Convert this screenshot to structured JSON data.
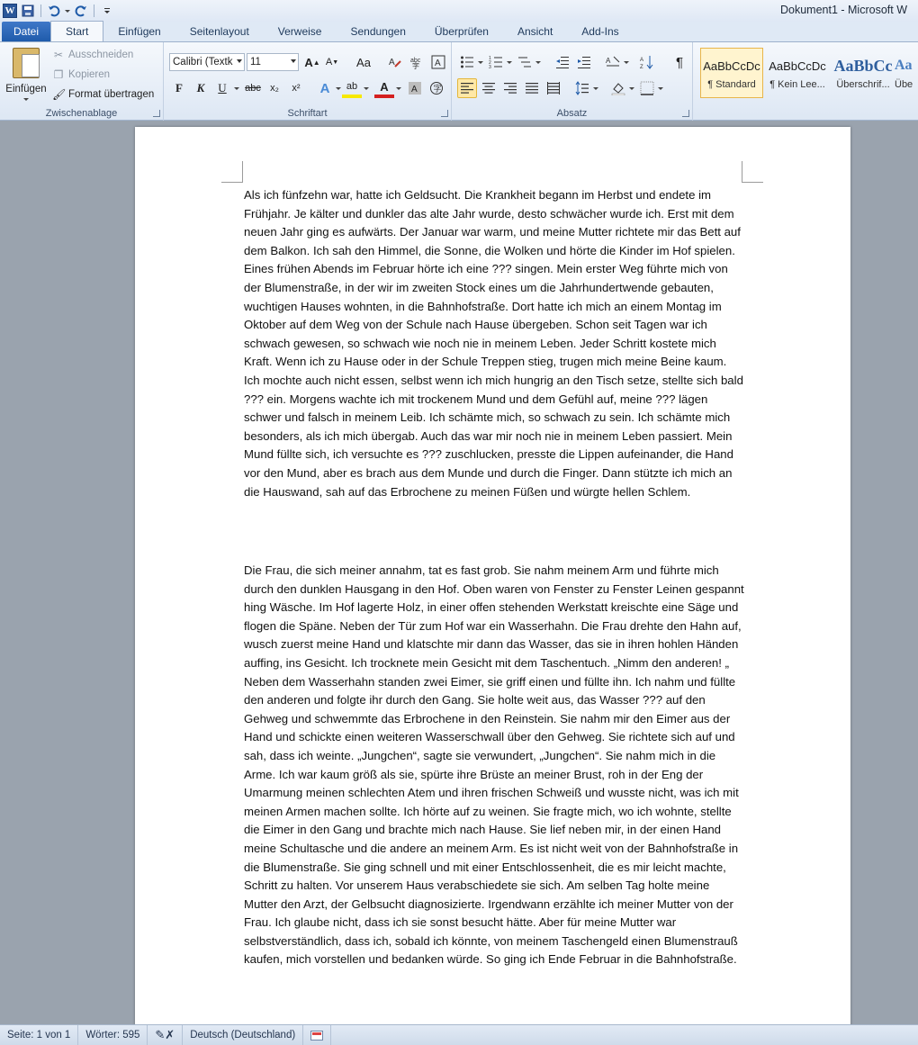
{
  "window": {
    "title": "Dokument1 - Microsoft W"
  },
  "qat": {
    "icons": [
      "word-logo",
      "save-icon",
      "undo-icon",
      "redo-icon",
      "customize-icon"
    ],
    "word_letter": "W"
  },
  "tabs": [
    "Datei",
    "Start",
    "Einfügen",
    "Seitenlayout",
    "Verweise",
    "Sendungen",
    "Überprüfen",
    "Ansicht",
    "Add-Ins"
  ],
  "ribbon": {
    "clipboard": {
      "paste_label": "Einfügen",
      "cut_label": "Ausschneiden",
      "copy_label": "Kopieren",
      "format_painter_label": "Format übertragen",
      "group_label": "Zwischenablage"
    },
    "font": {
      "font_name": "Calibri (Textk",
      "font_size": "11",
      "group_label": "Schriftart",
      "grow_label": "A",
      "shrink_label": "A",
      "case_label": "Aa",
      "bold_label": "F",
      "italic_label": "K",
      "underline_label": "U",
      "strike_label": "abc",
      "subscript_label": "x₂",
      "superscript_label": "x²",
      "effects_label": "A",
      "highlight_label": "ab",
      "color_label": "A"
    },
    "paragraph": {
      "group_label": "Absatz",
      "pilcrow": "¶"
    },
    "styles": {
      "items": [
        {
          "sample": "AaBbCcDc",
          "name": "¶ Standard"
        },
        {
          "sample": "AaBbCcDc",
          "name": "¶ Kein Lee..."
        },
        {
          "sample": "AaBbCc",
          "name": "Überschrif..."
        },
        {
          "sample": "Aa",
          "name": "Übe"
        }
      ]
    }
  },
  "document": {
    "paragraphs": [
      "Als ich fünfzehn war, hatte ich Geldsucht. Die Krankheit begann im Herbst und endete im Frühjahr. Je kälter und dunkler das alte Jahr wurde, desto schwächer wurde ich. Erst mit dem neuen Jahr ging es aufwärts. Der Januar war warm, und meine Mutter richtete mir das Bett auf dem Balkon. Ich sah den Himmel, die Sonne, die Wolken und hörte die Kinder im Hof spielen. Eines frühen Abends im Februar hörte ich eine ??? singen. Mein erster Weg führte mich von der Blumenstraße, in der wir im zweiten Stock eines um die Jahrhundertwende gebauten, wuchtigen Hauses wohnten, in die Bahnhofstraße. Dort hatte ich mich an einem Montag im Oktober auf dem Weg von der Schule nach Hause übergeben. Schon seit Tagen war ich schwach gewesen, so schwach wie noch nie in meinem Leben. Jeder Schritt kostete mich Kraft. Wenn ich zu Hause oder in der Schule Treppen stieg, trugen mich meine Beine kaum. Ich mochte auch nicht essen, selbst wenn ich mich hungrig an den Tisch setze, stellte sich bald ??? ein. Morgens wachte ich mit trockenem Mund und dem Gefühl auf, meine ??? lägen schwer und falsch in meinem Leib. Ich schämte mich, so schwach zu sein. Ich schämte mich besonders, als ich mich übergab. Auch das war mir noch nie in meinem Leben passiert. Mein Mund füllte sich, ich versuchte es ??? zuschlucken, presste die Lippen aufeinander, die Hand vor den Mund, aber es brach aus dem Munde und durch die Finger. Dann stützte ich mich an die Hauswand, sah auf das Erbrochene zu meinen Füßen und würgte hellen Schlem.",
      "Die Frau, die sich meiner annahm, tat es fast grob. Sie nahm meinem Arm und führte mich durch den dunklen Hausgang in den Hof. Oben waren von Fenster zu Fenster Leinen gespannt hing Wäsche. Im Hof lagerte Holz, in einer offen stehenden Werkstatt kreischte eine Säge und flogen die Späne. Neben der Tür zum Hof war ein Wasserhahn. Die Frau drehte den Hahn auf, wusch zuerst meine Hand und klatschte mir dann das Wasser, das sie in ihren hohlen Händen auffing, ins Gesicht. Ich trocknete mein Gesicht mit dem Taschentuch.  „Nimm den anderen! „ Neben dem Wasserhahn standen zwei Eimer, sie griff einen und füllte ihn. Ich nahm und füllte den anderen und folgte ihr durch den Gang. Sie holte weit aus, das Wasser ??? auf den Gehweg und schwemmte das Erbrochene in den Reinstein. Sie nahm mir den Eimer aus der Hand und schickte einen weiteren Wasserschwall über den Gehweg. Sie richtete sich auf und sah, dass ich weinte. „Jungchen“, sagte sie verwundert,  „Jungchen“.  Sie nahm mich in die Arme. Ich war kaum größ als sie, spürte ihre Brüste an meiner Brust, roh in der Eng der Umarmung meinen schlechten Atem und ihren frischen Schweiß und wusste nicht, was ich mit meinen Armen machen sollte. Ich hörte auf zu weinen.  Sie fragte mich, wo ich wohnte, stellte die Eimer in den Gang und brachte mich nach Hause. Sie lief neben mir, in der einen Hand meine Schultasche und die andere an meinem Arm. Es ist nicht weit von der Bahnhofstraße in die Blumenstraße. Sie ging schnell und mit einer Entschlossenheit, die es mir leicht machte, Schritt zu halten. Vor unserem Haus verabschiedete sie sich. Am selben Tag holte meine Mutter den Arzt, der Gelbsucht diagnosizierte. Irgendwann erzählte ich meiner Mutter von der Frau. Ich glaube nicht, dass ich sie sonst besucht hätte. Aber für meine Mutter war selbstverständlich, dass ich, sobald ich könnte, von meinem Taschengeld einen Blumenstrauß kaufen, mich vorstellen und bedanken würde. So ging ich Ende Februar in die Bahnhofstraße."
    ]
  },
  "status": {
    "page": "Seite: 1 von 1",
    "words": "Wörter: 595",
    "language": "Deutsch (Deutschland)"
  }
}
